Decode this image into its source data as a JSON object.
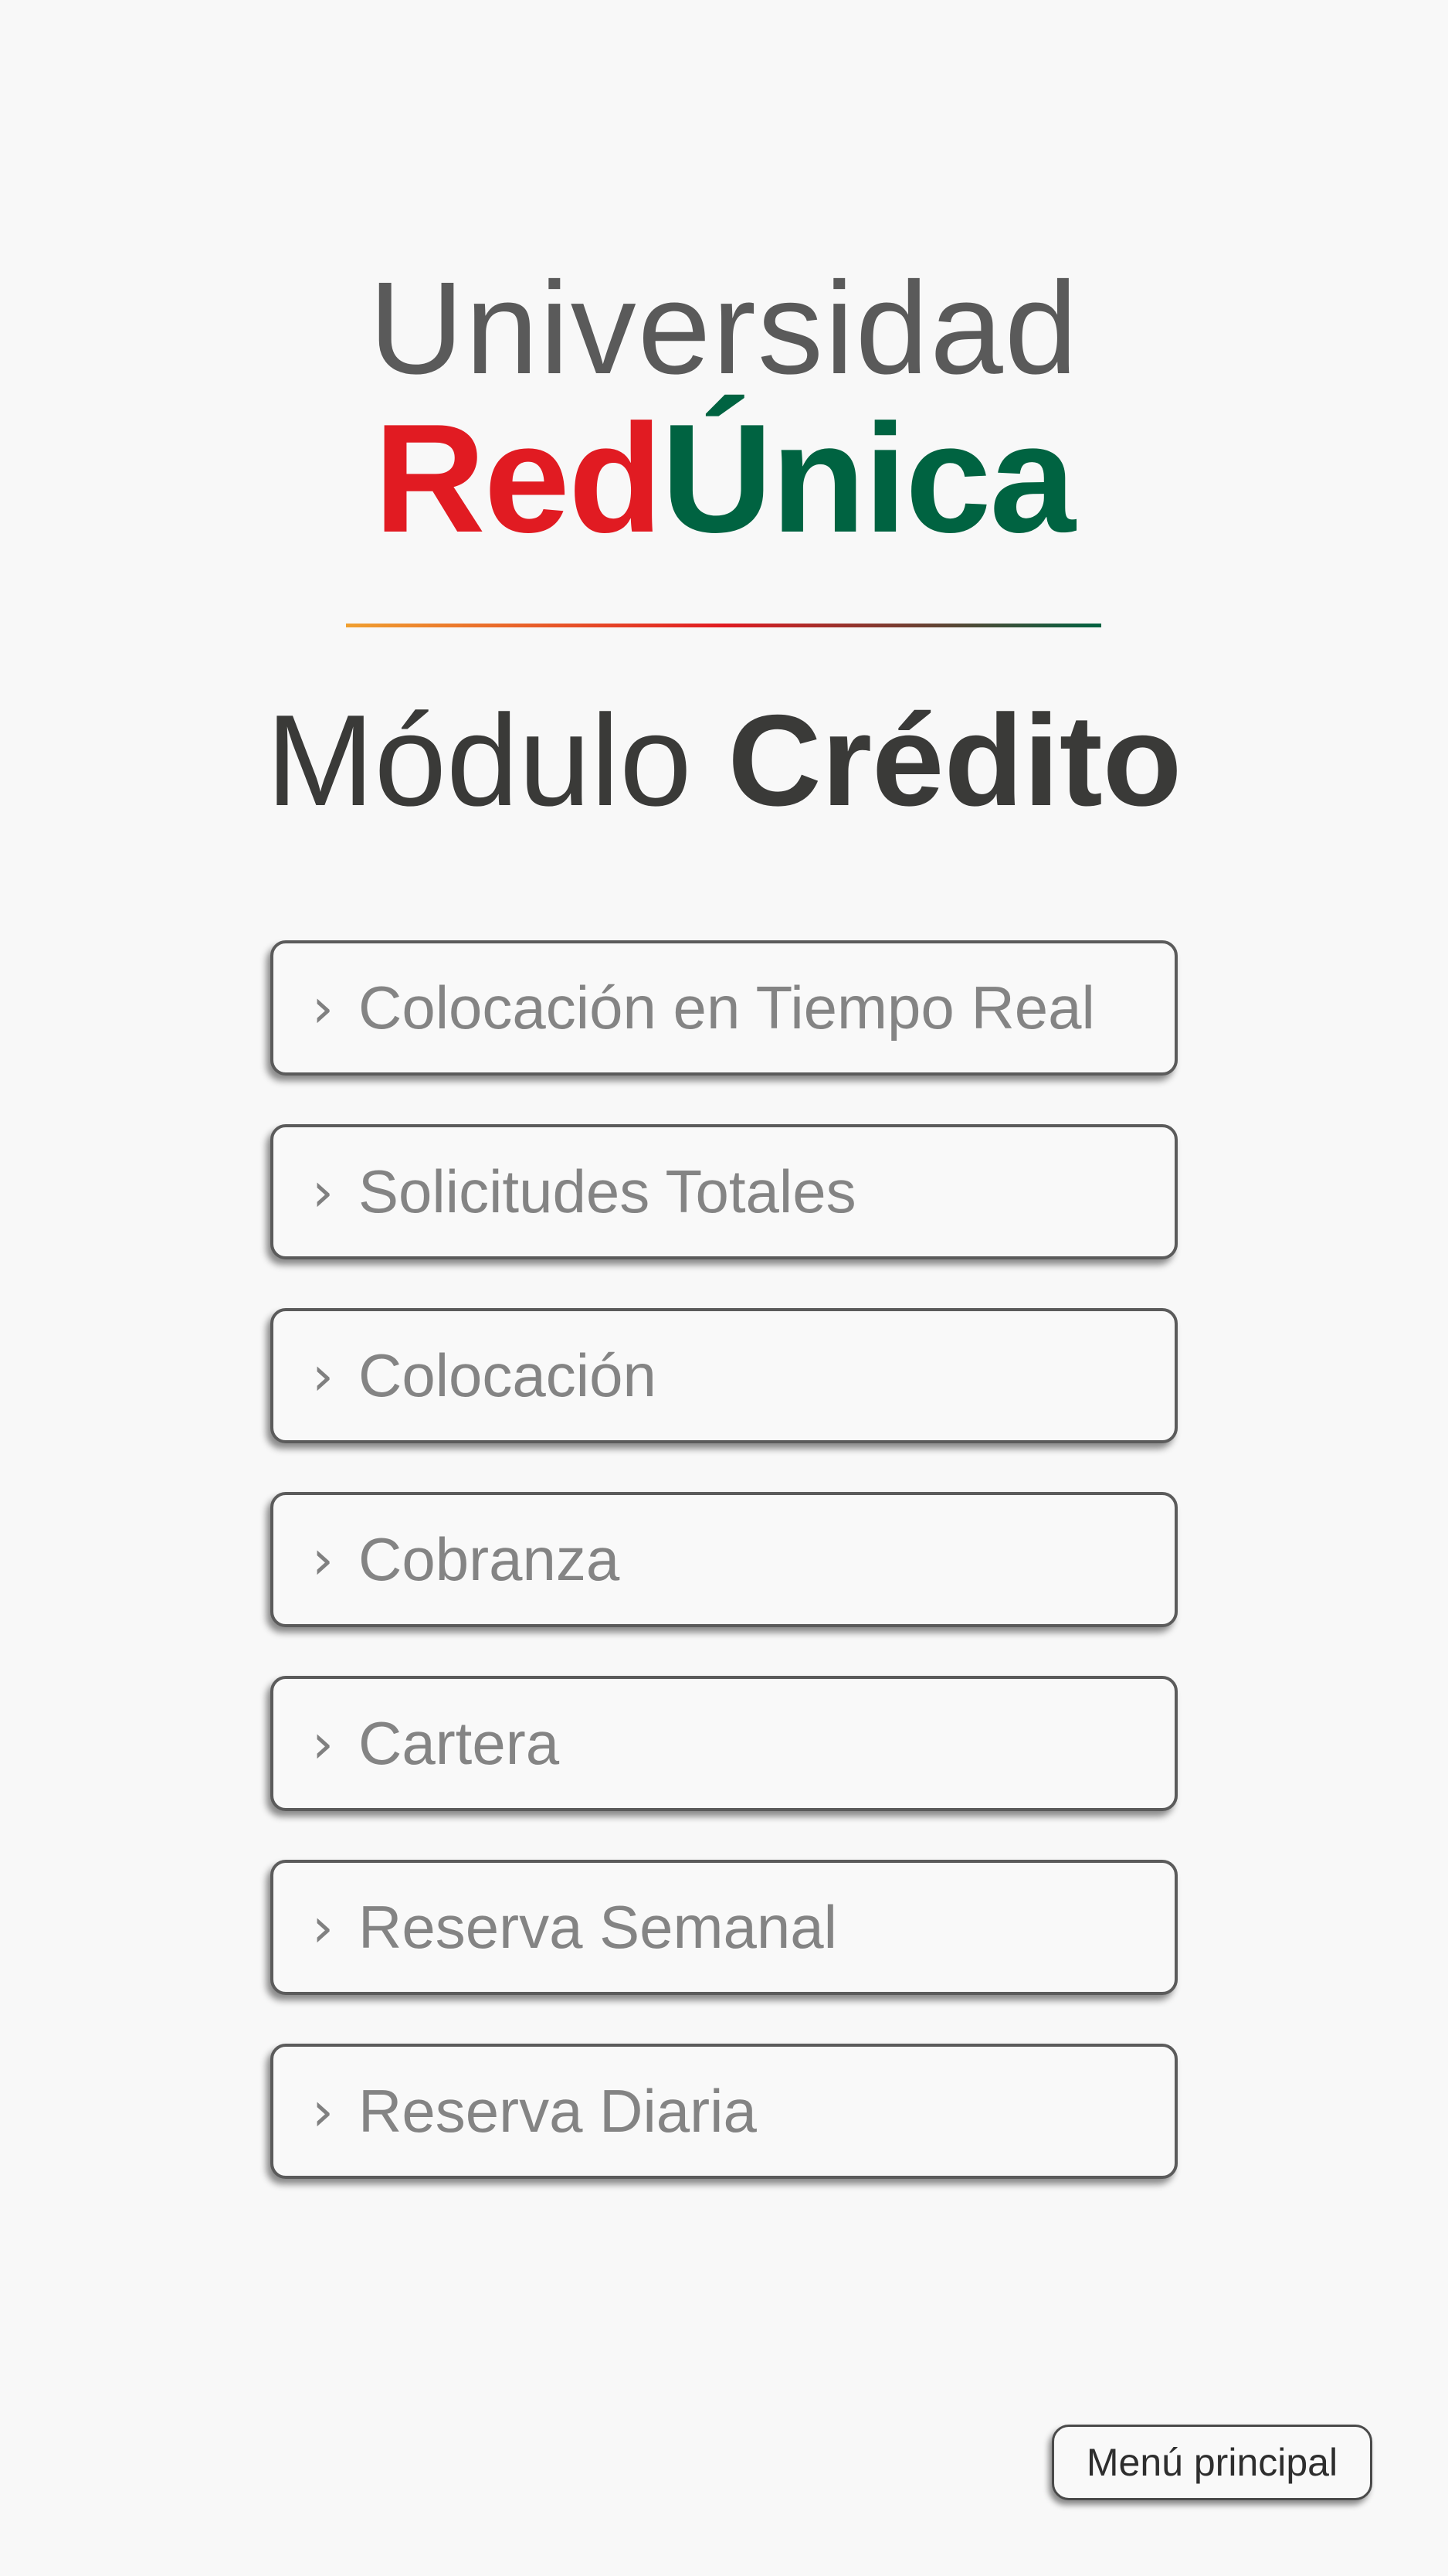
{
  "logo": {
    "line1": "Universidad",
    "red_part": "Red",
    "green_part": "Única",
    "colors": {
      "red": "#e11b22",
      "green": "#006341",
      "gray": "#5a5a5a"
    }
  },
  "title": {
    "light": "Módulo",
    "bold": "Crédito"
  },
  "menu": {
    "chevron": "›",
    "items": [
      {
        "label": "Colocación en Tiempo Real"
      },
      {
        "label": "Solicitudes Totales"
      },
      {
        "label": "Colocación"
      },
      {
        "label": "Cobranza"
      },
      {
        "label": "Cartera"
      },
      {
        "label": "Reserva Semanal"
      },
      {
        "label": "Reserva Diaria"
      }
    ]
  },
  "footer": {
    "main_menu_label": "Menú principal"
  }
}
